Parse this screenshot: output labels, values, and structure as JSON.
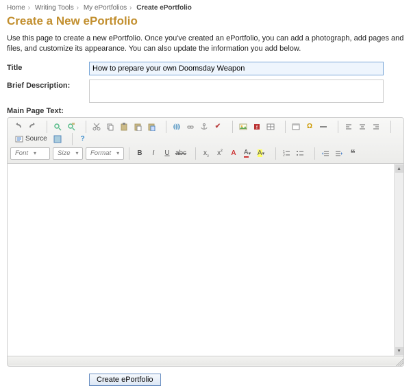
{
  "breadcrumb": {
    "items": [
      "Home",
      "Writing Tools",
      "My ePortfolios"
    ],
    "current": "Create ePortfolio"
  },
  "heading": "Create a New ePortfolio",
  "intro": "Use this page to create a new ePortfolio. Once you've created an ePortfolio, you can add a photograph, add pages and files, and customize its appearance. You can also update the information you add below.",
  "labels": {
    "title": "Title",
    "brief": "Brief Description:",
    "main": "Main Page Text:"
  },
  "values": {
    "title": "How to prepare your own Doomsday Weapon",
    "brief": "",
    "main": ""
  },
  "toolbar": {
    "combos": {
      "font": "Font",
      "size": "Size",
      "format": "Format"
    },
    "source": "Source"
  },
  "submit": "Create ePortfolio"
}
